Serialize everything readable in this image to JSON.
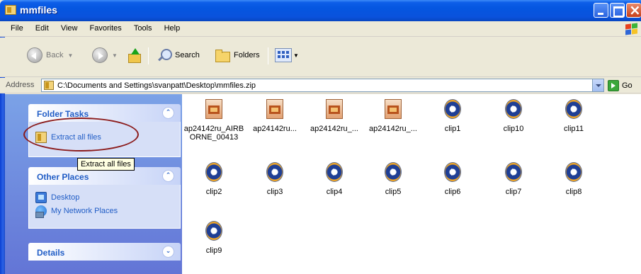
{
  "window": {
    "title": "mmfiles"
  },
  "menu": {
    "items": [
      "File",
      "Edit",
      "View",
      "Favorites",
      "Tools",
      "Help"
    ]
  },
  "toolbar": {
    "back_label": "Back",
    "search_label": "Search",
    "folders_label": "Folders"
  },
  "address": {
    "label": "Address",
    "value": "C:\\Documents and Settings\\svanpatt\\Desktop\\mmfiles.zip",
    "go_label": "Go"
  },
  "taskpane": {
    "folder_tasks": {
      "title": "Folder Tasks",
      "items": [
        "Extract all files"
      ]
    },
    "tooltip": "Extract all files",
    "other_places": {
      "title": "Other Places",
      "items": [
        "Desktop",
        "My Network Places"
      ]
    },
    "details": {
      "title": "Details"
    }
  },
  "files": [
    {
      "name": "ap24142ru_AIRBORNE_00413",
      "type": "zip-file-icon"
    },
    {
      "name": "ap24142ru...",
      "type": "zip-file-icon"
    },
    {
      "name": "ap24142ru_...",
      "type": "zip-file-icon"
    },
    {
      "name": "ap24142ru_...",
      "type": "zip-file-icon"
    },
    {
      "name": "clip1",
      "type": "media-file-icon"
    },
    {
      "name": "clip10",
      "type": "media-file-icon"
    },
    {
      "name": "clip11",
      "type": "media-file-icon"
    },
    {
      "name": "clip2",
      "type": "media-file-icon"
    },
    {
      "name": "clip3",
      "type": "media-file-icon"
    },
    {
      "name": "clip4",
      "type": "media-file-icon"
    },
    {
      "name": "clip5",
      "type": "media-file-icon"
    },
    {
      "name": "clip6",
      "type": "media-file-icon"
    },
    {
      "name": "clip7",
      "type": "media-file-icon"
    },
    {
      "name": "clip8",
      "type": "media-file-icon"
    },
    {
      "name": "clip9",
      "type": "media-file-icon"
    }
  ],
  "colors": {
    "titlebar": "#0556e0",
    "taskpane": "#6375d6",
    "link": "#215dc6",
    "annotation": "#8b1a1a"
  }
}
